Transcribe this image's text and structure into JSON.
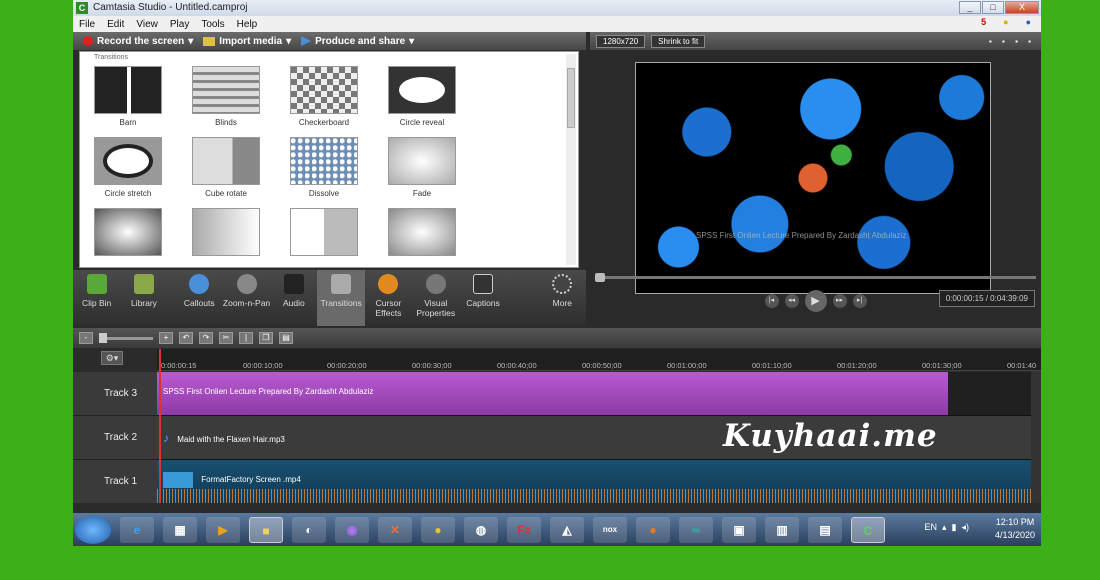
{
  "window": {
    "title": "Camtasia Studio - Untitled.camproj",
    "app_icon_letter": "C",
    "controls": [
      "_",
      "□",
      "X"
    ]
  },
  "menu": [
    "File",
    "Edit",
    "View",
    "Play",
    "Tools",
    "Help"
  ],
  "menu_right": {
    "count": "5"
  },
  "toolbar": {
    "record": "Record the screen",
    "import": "Import media",
    "produce": "Produce and share"
  },
  "transitions": {
    "section_label": "Transitions",
    "items": [
      "Barn",
      "Blinds",
      "Checkerboard",
      "Circle reveal",
      "Circle stretch",
      "Cube rotate",
      "Dissolve",
      "Fade",
      "",
      "",
      "",
      ""
    ]
  },
  "tasks": [
    {
      "label": "Clip Bin",
      "icon": "clip-bin-icon",
      "color": "#5aa83a"
    },
    {
      "label": "Library",
      "icon": "library-icon",
      "color": "#8aa84a"
    },
    {
      "label": "Callouts",
      "icon": "callouts-icon",
      "color": "#4a90d9"
    },
    {
      "label": "Zoom-n-Pan",
      "icon": "zoom-icon",
      "color": "#888888"
    },
    {
      "label": "Audio",
      "icon": "audio-icon",
      "color": "#222222"
    },
    {
      "label": "Transitions",
      "icon": "transitions-icon",
      "color": "#aaaaaa"
    },
    {
      "label": "Cursor Effects",
      "icon": "cursor-effects-icon",
      "color": "#e08a20"
    },
    {
      "label": "Visual Properties",
      "icon": "visual-properties-icon",
      "color": "#777777"
    },
    {
      "label": "Captions",
      "icon": "captions-icon",
      "color": "#333333"
    },
    {
      "label": "More",
      "icon": "more-icon",
      "color": "#444444"
    }
  ],
  "preview": {
    "dimensions": "1280x720",
    "zoom": "Shrink to fit",
    "canvas_caption": "SPSS First Onlien Lecture Prepared By Zardasht Abdulaziz",
    "time": "0:00:00:15 / 0:04:39:09"
  },
  "timeline": {
    "ticks": [
      "0:00:00:15",
      "00:00:10;00",
      "00:00:20;00",
      "00:00:30;00",
      "00:00:40;00",
      "00:00:50;00",
      "00:01:00;00",
      "00:01:10;00",
      "00:01:20;00",
      "00:01:30;00",
      "00:01:40"
    ],
    "tracks": [
      {
        "name": "Track 3",
        "clip": "SPSS First Onlien Lecture Prepared By Zardasht Abdulaziz"
      },
      {
        "name": "Track 2",
        "clip": "Maid with the Flaxen Hair.mp3"
      },
      {
        "name": "Track 1",
        "clip": "FormatFactory Screen .mp4"
      }
    ]
  },
  "watermark": "Kuyhaai.me",
  "taskbar": {
    "lang": "EN",
    "time": "12:10 PM",
    "date": "4/13/2020"
  }
}
